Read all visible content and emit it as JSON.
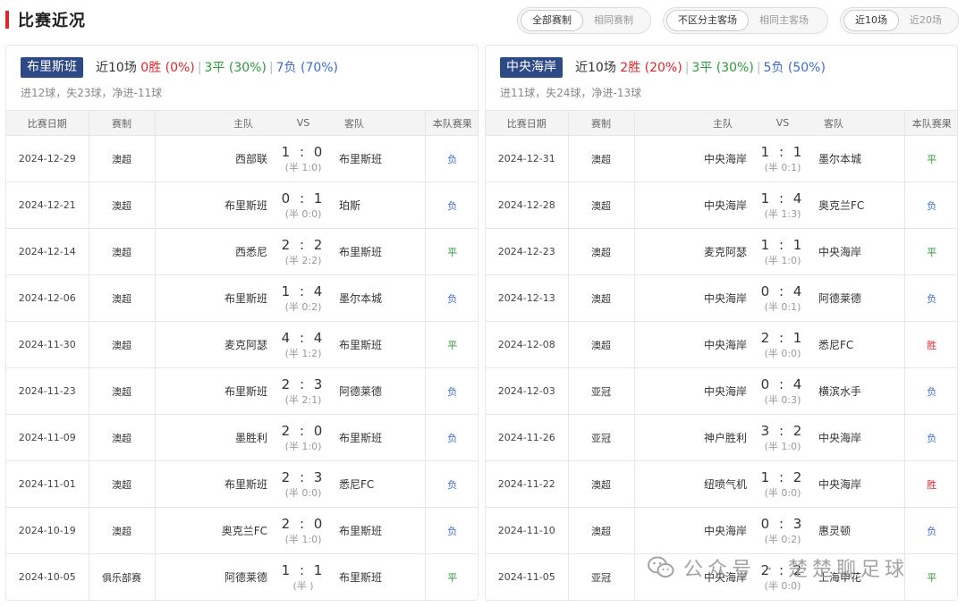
{
  "header": {
    "title": "比赛近况"
  },
  "filters": {
    "competition": [
      "全部赛制",
      "相同赛制"
    ],
    "venue": [
      "不区分主客场",
      "相同主客场"
    ],
    "range": [
      "近10场",
      "近20场"
    ]
  },
  "table_headers": {
    "date": "比赛日期",
    "comp": "赛制",
    "home": "主队",
    "vs": "VS",
    "away": "客队",
    "result": "本队赛果"
  },
  "teams": [
    {
      "name": "布里斯班",
      "recent": "近10场",
      "wins": "0胜 (0%)",
      "draws": "3平 (30%)",
      "losses": "7负 (70%)",
      "goals": "进12球，失23球，净进-11球",
      "matches": [
        {
          "date": "2024-12-29",
          "comp": "澳超",
          "home": "西部联",
          "score": "1 : 0",
          "ht": "(半 1:0)",
          "away": "布里斯班",
          "result": "负",
          "rtype": "loss",
          "bold": "away"
        },
        {
          "date": "2024-12-21",
          "comp": "澳超",
          "home": "布里斯班",
          "score": "0 : 1",
          "ht": "(半 0:0)",
          "away": "珀斯",
          "result": "负",
          "rtype": "loss",
          "bold": "home"
        },
        {
          "date": "2024-12-14",
          "comp": "澳超",
          "home": "西悉尼",
          "score": "2 : 2",
          "ht": "(半 2:2)",
          "away": "布里斯班",
          "result": "平",
          "rtype": "draw",
          "bold": "away"
        },
        {
          "date": "2024-12-06",
          "comp": "澳超",
          "home": "布里斯班",
          "score": "1 : 4",
          "ht": "(半 0:2)",
          "away": "墨尔本城",
          "result": "负",
          "rtype": "loss",
          "bold": "home"
        },
        {
          "date": "2024-11-30",
          "comp": "澳超",
          "home": "麦克阿瑟",
          "score": "4 : 4",
          "ht": "(半 1:2)",
          "away": "布里斯班",
          "result": "平",
          "rtype": "draw",
          "bold": "away"
        },
        {
          "date": "2024-11-23",
          "comp": "澳超",
          "home": "布里斯班",
          "score": "2 : 3",
          "ht": "(半 2:1)",
          "away": "阿德莱德",
          "result": "负",
          "rtype": "loss",
          "bold": "home"
        },
        {
          "date": "2024-11-09",
          "comp": "澳超",
          "home": "墨胜利",
          "score": "2 : 0",
          "ht": "(半 1:0)",
          "away": "布里斯班",
          "result": "负",
          "rtype": "loss",
          "bold": "away"
        },
        {
          "date": "2024-11-01",
          "comp": "澳超",
          "home": "布里斯班",
          "score": "2 : 3",
          "ht": "(半 0:0)",
          "away": "悉尼FC",
          "result": "负",
          "rtype": "loss",
          "bold": "home"
        },
        {
          "date": "2024-10-19",
          "comp": "澳超",
          "home": "奥克兰FC",
          "score": "2 : 0",
          "ht": "(半 1:0)",
          "away": "布里斯班",
          "result": "负",
          "rtype": "loss",
          "bold": "away"
        },
        {
          "date": "2024-10-05",
          "comp": "俱乐部赛",
          "home": "阿德莱德",
          "score": "1 : 1",
          "ht": "(半 )",
          "away": "布里斯班",
          "result": "平",
          "rtype": "draw",
          "bold": "away"
        }
      ]
    },
    {
      "name": "中央海岸",
      "recent": "近10场",
      "wins": "2胜 (20%)",
      "draws": "3平 (30%)",
      "losses": "5负 (50%)",
      "goals": "进11球，失24球，净进-13球",
      "matches": [
        {
          "date": "2024-12-31",
          "comp": "澳超",
          "home": "中央海岸",
          "score": "1 : 1",
          "ht": "(半 0:1)",
          "away": "墨尔本城",
          "result": "平",
          "rtype": "draw",
          "bold": "home"
        },
        {
          "date": "2024-12-28",
          "comp": "澳超",
          "home": "中央海岸",
          "score": "1 : 4",
          "ht": "(半 1:3)",
          "away": "奥克兰FC",
          "result": "负",
          "rtype": "loss",
          "bold": "home"
        },
        {
          "date": "2024-12-23",
          "comp": "澳超",
          "home": "麦克阿瑟",
          "score": "1 : 1",
          "ht": "(半 1:0)",
          "away": "中央海岸",
          "result": "平",
          "rtype": "draw",
          "bold": "away"
        },
        {
          "date": "2024-12-13",
          "comp": "澳超",
          "home": "中央海岸",
          "score": "0 : 4",
          "ht": "(半 0:1)",
          "away": "阿德莱德",
          "result": "负",
          "rtype": "loss",
          "bold": "home"
        },
        {
          "date": "2024-12-08",
          "comp": "澳超",
          "home": "中央海岸",
          "score": "2 : 1",
          "ht": "(半 0:0)",
          "away": "悉尼FC",
          "result": "胜",
          "rtype": "win",
          "bold": "home"
        },
        {
          "date": "2024-12-03",
          "comp": "亚冠",
          "home": "中央海岸",
          "score": "0 : 4",
          "ht": "(半 0:3)",
          "away": "横滨水手",
          "result": "负",
          "rtype": "loss",
          "bold": "home"
        },
        {
          "date": "2024-11-26",
          "comp": "亚冠",
          "home": "神户胜利",
          "score": "3 : 2",
          "ht": "(半 1:0)",
          "away": "中央海岸",
          "result": "负",
          "rtype": "loss",
          "bold": "away"
        },
        {
          "date": "2024-11-22",
          "comp": "澳超",
          "home": "纽喷气机",
          "score": "1 : 2",
          "ht": "(半 0:0)",
          "away": "中央海岸",
          "result": "胜",
          "rtype": "win",
          "bold": "away"
        },
        {
          "date": "2024-11-10",
          "comp": "澳超",
          "home": "中央海岸",
          "score": "0 : 3",
          "ht": "(半 0:2)",
          "away": "惠灵顿",
          "result": "负",
          "rtype": "loss",
          "bold": "home"
        },
        {
          "date": "2024-11-05",
          "comp": "亚冠",
          "home": "中央海岸",
          "score": "2 : 2",
          "ht": "(半 0:0)",
          "away": "上海申花",
          "result": "平",
          "rtype": "draw",
          "bold": "home"
        }
      ]
    }
  ],
  "watermark": {
    "text": "公众号 · 楚楚聊足球"
  }
}
